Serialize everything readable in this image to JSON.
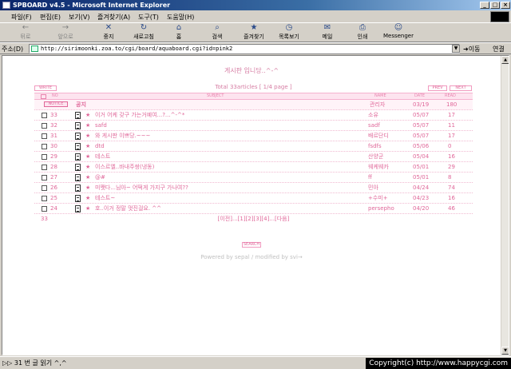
{
  "window": {
    "title": "SPBOARD v4.5 - Microsoft Internet Explorer"
  },
  "menu": [
    "파일(F)",
    "편집(E)",
    "보기(V)",
    "즐겨찾기(A)",
    "도구(T)",
    "도움말(H)"
  ],
  "toolbar": [
    {
      "label": "뒤로",
      "icon": "←",
      "disabled": true
    },
    {
      "label": "앞으로",
      "icon": "→",
      "disabled": true
    },
    {
      "label": "중지",
      "icon": "✕",
      "disabled": false
    },
    {
      "label": "새로고침",
      "icon": "↻",
      "disabled": false
    },
    {
      "label": "홈",
      "icon": "⌂",
      "disabled": false
    },
    {
      "label": "검색",
      "icon": "⌕",
      "disabled": false
    },
    {
      "label": "즐겨찾기",
      "icon": "★",
      "disabled": false
    },
    {
      "label": "목록보기",
      "icon": "◷",
      "disabled": false
    },
    {
      "label": "메일",
      "icon": "✉",
      "disabled": false
    },
    {
      "label": "인쇄",
      "icon": "⎙",
      "disabled": false
    },
    {
      "label": "Messenger",
      "icon": "☺",
      "disabled": false
    }
  ],
  "address": {
    "label": "주소(D)",
    "url": "http://sirimoonki.zoa.to/cgi/board/aquaboard.cgi?id=pink2",
    "go": "이동",
    "links": "연결"
  },
  "board": {
    "notice": "게시판 입니당..^-^",
    "write_btn": "WRITE",
    "total": "Total 33articles [ 1/4 page ]",
    "prev_btn": "PREV",
    "next_btn": "NEXT",
    "headers": {
      "no": "NO",
      "subject": "SUBJECT",
      "name": "NAME",
      "date": "DATE",
      "read": "READ"
    },
    "notice_row": {
      "badge": "NOTICE",
      "subject": "공지",
      "name": "관리자",
      "date": "03/19",
      "read": "180"
    },
    "rows": [
      {
        "no": "33",
        "subject": "이거 어케 갖구 가는거예여...?...^-^*",
        "name": "소유",
        "date": "05/07",
        "read": "17"
      },
      {
        "no": "32",
        "subject": "safd",
        "name": "sadf",
        "date": "05/07",
        "read": "11"
      },
      {
        "no": "31",
        "subject": "와 게시판 이쁘당.~~~",
        "name": "배르단디",
        "date": "05/07",
        "read": "17"
      },
      {
        "no": "30",
        "subject": "dtd",
        "name": "fsdfs",
        "date": "05/06",
        "read": "0"
      },
      {
        "no": "29",
        "subject": "테스트",
        "name": "산양군",
        "date": "05/04",
        "read": "16"
      },
      {
        "no": "28",
        "subject": "이스르엘..바내주쌍(냉동)",
        "name": "웨케웨카",
        "date": "05/01",
        "read": "29"
      },
      {
        "no": "27",
        "subject": "@#",
        "name": "ff",
        "date": "05/01",
        "read": "8"
      },
      {
        "no": "26",
        "subject": "미쨋다...님아~ 어떡게 가지구 가나여??",
        "name": "민아",
        "date": "04/24",
        "read": "74"
      },
      {
        "no": "25",
        "subject": "테스트~",
        "name": "+수미+",
        "date": "04/23",
        "read": "16"
      },
      {
        "no": "24",
        "subject": "호..이거 정말 멋진걸요. ^^",
        "name": "persepho",
        "date": "04/20",
        "read": "46"
      }
    ],
    "footer_count": "33",
    "paging": "[이전]...[1][2][3][4]...[다음]",
    "search_btn": "SEARCH",
    "credit": "Powered by sepal / modified by svi→"
  },
  "statusbar": {
    "text": "▷▷ 31 번 글 읽기 ^,^",
    "copyright": "Copyright(c) http://www.happycgi.com"
  }
}
